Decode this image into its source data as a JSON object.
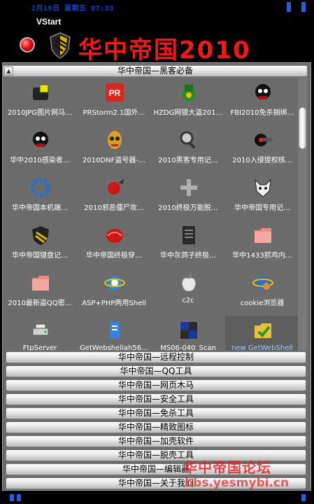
{
  "header": {
    "datetime": "2月19日 星期五 07:33",
    "vstart_label": "VStart",
    "app_title": "华中帝国2010"
  },
  "open_group": {
    "title": "华中帝国—黑客必备",
    "items": [
      {
        "label": "2010JPG图片网马…",
        "icon": "jpg-trojan-icon"
      },
      {
        "label": "PRStorm2.1国外…",
        "icon": "pr-storm-icon"
      },
      {
        "label": "HZDG网银大盗201…",
        "icon": "bank-thief-icon"
      },
      {
        "label": "FBI2010免杀捆绑…",
        "icon": "skull-binder-icon"
      },
      {
        "label": "华中2010感染者…",
        "icon": "skull-infector-icon"
      },
      {
        "label": "2010DNF盗号器-…",
        "icon": "mask-stealer-icon"
      },
      {
        "label": "2010黑客专用记…",
        "icon": "magnifier-recorder-icon"
      },
      {
        "label": "2010入侵提权核…",
        "icon": "gun-exploit-icon"
      },
      {
        "label": "华中帝国本机端…",
        "icon": "gear-icon"
      },
      {
        "label": "2010邪恶僵尸攻…",
        "icon": "zombie-attack-icon"
      },
      {
        "label": "2010终极万能脱…",
        "icon": "cross-unpacker-icon"
      },
      {
        "label": "华中帝国专用记…",
        "icon": "fox-logo-icon"
      },
      {
        "label": "华中帝国键盘记…",
        "icon": "shield-keylogger-icon"
      },
      {
        "label": "华中帝国终极穿…",
        "icon": "red-shell-icon"
      },
      {
        "label": "华中灰鸽子终极…",
        "icon": "text-file-icon"
      },
      {
        "label": "华中1433抓鸡内…",
        "icon": "folder-icon"
      },
      {
        "label": "2010最新盗QQ密…",
        "icon": "folder-icon"
      },
      {
        "label": "ASP+PHP两用Shell",
        "icon": "ie-browser-icon"
      },
      {
        "label": "c2c",
        "icon": "apple-icon"
      },
      {
        "label": "cookie浏览器",
        "icon": "ie-cookie-icon"
      },
      {
        "label": "FtpServer",
        "icon": "ftp-server-icon"
      },
      {
        "label": "GetWebshellah56…",
        "icon": "webshell-scroll-icon"
      },
      {
        "label": "MS06-040_Scan",
        "icon": "scan-blocks-icon"
      },
      {
        "label": "new GetWebShell",
        "icon": "folder-check-icon"
      },
      {
        "label": "",
        "icon": "chart-arrow-icon"
      },
      {
        "label": "",
        "icon": "download-orb-icon"
      },
      {
        "label": "",
        "icon": "windows-tool-icon"
      },
      {
        "label": "",
        "icon": "smiley-icon"
      }
    ]
  },
  "collapsed_groups": [
    {
      "label": "华中帝国—远程控制"
    },
    {
      "label": "华中帝国—QQ工具"
    },
    {
      "label": "华中帝国—网页木马"
    },
    {
      "label": "华中帝国—安全工具"
    },
    {
      "label": "华中帝国—免杀工具"
    },
    {
      "label": "华中帝国—精致图标"
    },
    {
      "label": "华中帝国—加壳软件"
    },
    {
      "label": "华中帝国—脱壳工具"
    },
    {
      "label": "华中帝国—编辑器"
    },
    {
      "label": "华中帝国—关于我们"
    }
  ],
  "watermark": {
    "line1": "华中帝国论坛",
    "line2": "bbs.yesmybi.cn"
  },
  "colors": {
    "title_red": "#f01818",
    "accent_blue": "#2a5be0",
    "panel_gray": "#6c6c6c"
  }
}
